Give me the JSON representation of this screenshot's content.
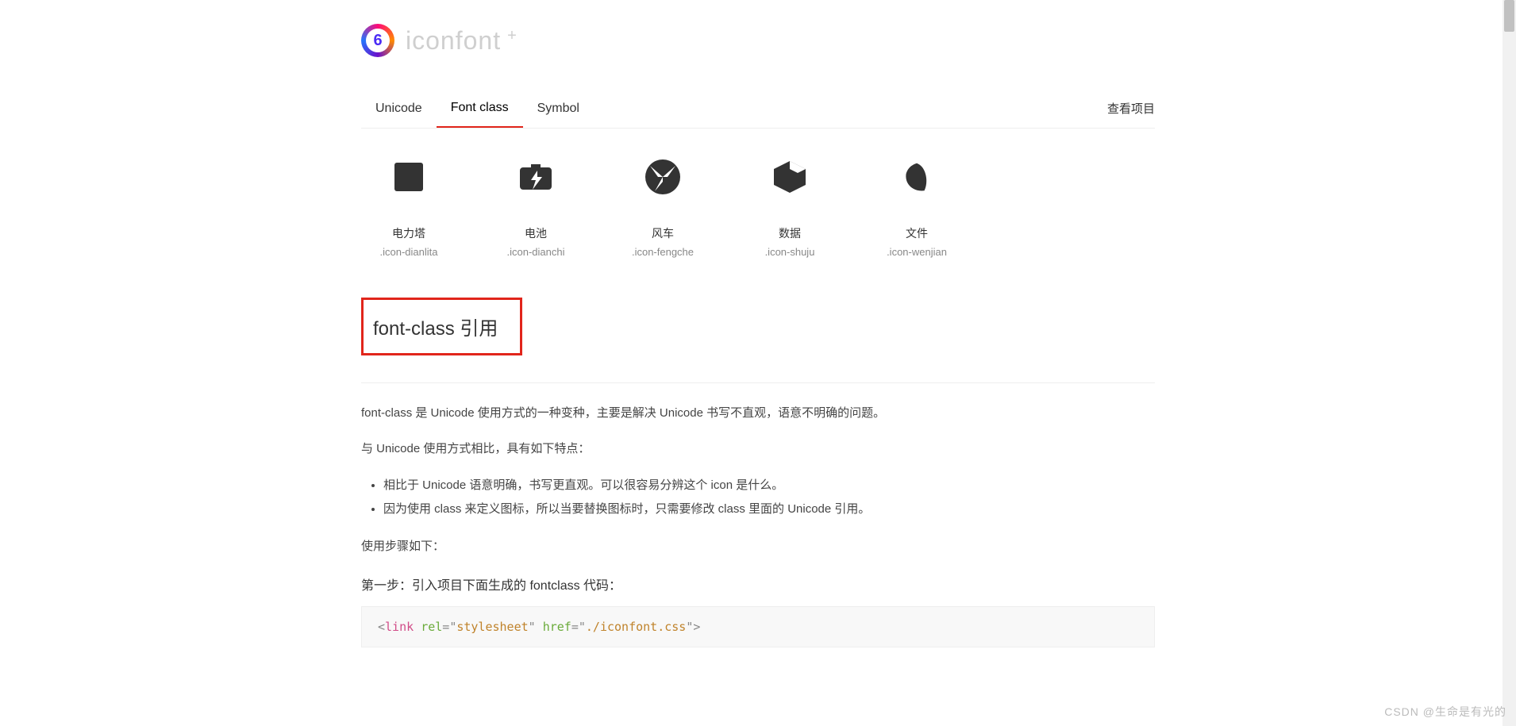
{
  "logo": {
    "text": "iconfont",
    "plus": "+"
  },
  "tabs": {
    "items": [
      {
        "label": "Unicode"
      },
      {
        "label": "Font class"
      },
      {
        "label": "Symbol"
      }
    ],
    "active_index": 1,
    "right_link": "查看项目"
  },
  "icons": [
    {
      "label": "电力塔",
      "class": ".icon-dianlita"
    },
    {
      "label": "电池",
      "class": ".icon-dianchi"
    },
    {
      "label": "风车",
      "class": ".icon-fengche"
    },
    {
      "label": "数据",
      "class": ".icon-shuju"
    },
    {
      "label": "文件",
      "class": ".icon-wenjian"
    }
  ],
  "section": {
    "title": "font-class 引用",
    "para1": "font-class 是 Unicode 使用方式的一种变种，主要是解决 Unicode 书写不直观，语意不明确的问题。",
    "para2": "与 Unicode 使用方式相比，具有如下特点：",
    "bullets": [
      "相比于 Unicode 语意明确，书写更直观。可以很容易分辨这个 icon 是什么。",
      "因为使用 class 来定义图标，所以当要替换图标时，只需要修改 class 里面的 Unicode 引用。"
    ],
    "para3": "使用步骤如下：",
    "step1": "第一步：引入项目下面生成的 fontclass 代码：",
    "code": {
      "tag": "link",
      "attr1": "rel",
      "val1": "stylesheet",
      "attr2": "href",
      "val2": "./iconfont.css"
    }
  },
  "watermark": "CSDN @生命是有光的"
}
